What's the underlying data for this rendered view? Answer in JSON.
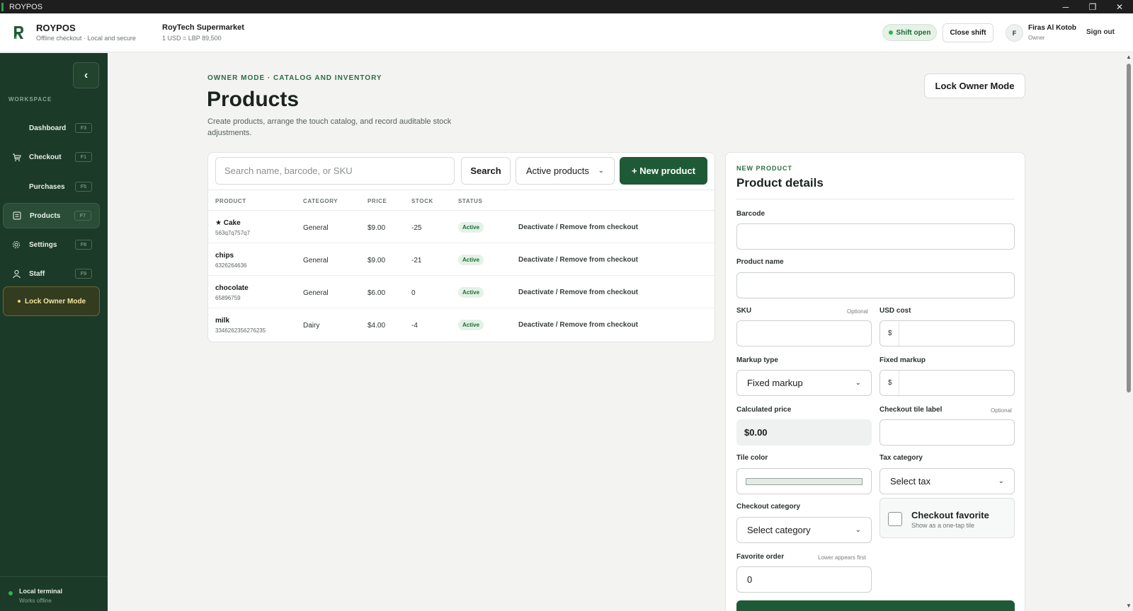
{
  "os": {
    "title": "ROYPOS",
    "minimize": "─",
    "maximize": "❐",
    "close": "✕"
  },
  "header": {
    "brand_name": "ROYPOS",
    "brand_tagline": "Offline checkout · Local and secure",
    "store_name": "RoyTech Supermarket",
    "exchange_rate": "1 USD = LBP 89,500",
    "shift_status": "Shift open",
    "close_shift": "Close shift",
    "avatar_initial": "F",
    "user_name": "Firas Al Kotob",
    "user_role": "Owner",
    "sign_out": "Sign out"
  },
  "sidebar": {
    "collapse_icon": "‹",
    "section_label": "WORKSPACE",
    "items": [
      {
        "label": "Dashboard",
        "key": "F3",
        "icon": "dashboard-icon",
        "glyph": ""
      },
      {
        "label": "Checkout",
        "key": "F1",
        "icon": "cart-icon",
        "glyph": "🛒"
      },
      {
        "label": "Purchases",
        "key": "F5",
        "icon": "purchases-icon",
        "glyph": ""
      },
      {
        "label": "Products",
        "key": "F7",
        "icon": "box-icon",
        "glyph": "▤",
        "active": true
      },
      {
        "label": "Settings",
        "key": "F8",
        "icon": "gear-icon",
        "glyph": "⚙"
      },
      {
        "label": "Staff",
        "key": "F9",
        "icon": "user-icon",
        "glyph": "👤"
      }
    ],
    "lock_owner_mode": "Lock Owner Mode",
    "terminal_name": "Local terminal",
    "terminal_status": "Works offline"
  },
  "main": {
    "eyebrow": "OWNER MODE · CATALOG AND INVENTORY",
    "title": "Products",
    "description": "Create products, arrange the touch catalog, and record auditable stock adjustments.",
    "lock_owner_mode": "Lock Owner Mode"
  },
  "list": {
    "search_placeholder": "Search name, barcode, or SKU",
    "search_button": "Search",
    "filter_selected": "Active products",
    "new_product": "+ New product",
    "columns": [
      "PRODUCT",
      "CATEGORY",
      "PRICE",
      "STOCK",
      "STATUS"
    ],
    "rows": [
      {
        "name": "★ Cake",
        "code": "563q7q757q7",
        "category": "General",
        "price": "$9.00",
        "stock": "-25",
        "status": "Active",
        "action": "Deactivate / Remove from checkout"
      },
      {
        "name": "chips",
        "code": "6326264636",
        "category": "General",
        "price": "$9.00",
        "stock": "-21",
        "status": "Active",
        "action": "Deactivate / Remove from checkout"
      },
      {
        "name": "chocolate",
        "code": "65896759",
        "category": "General",
        "price": "$6.00",
        "stock": "0",
        "status": "Active",
        "action": "Deactivate / Remove from checkout"
      },
      {
        "name": "milk",
        "code": "3346262356276235",
        "category": "Dairy",
        "price": "$4.00",
        "stock": "-4",
        "status": "Active",
        "action": "Deactivate / Remove from checkout"
      }
    ]
  },
  "form": {
    "eyebrow": "NEW PRODUCT",
    "title": "Product details",
    "barcode_label": "Barcode",
    "barcode_value": "",
    "name_label": "Product name",
    "name_value": "",
    "sku_label": "SKU",
    "sku_hint": "Optional",
    "sku_value": "",
    "usd_cost_label": "USD cost",
    "usd_cost_prefix": "$",
    "usd_cost_value": "",
    "markup_type_label": "Markup type",
    "markup_type_value": "Fixed markup",
    "fixed_markup_label": "Fixed markup",
    "fixed_markup_prefix": "$",
    "fixed_markup_value": "",
    "calculated_price_label": "Calculated price",
    "calculated_price_value": "$0.00",
    "tile_label_label": "Checkout tile label",
    "tile_label_hint": "Optional",
    "tile_label_value": "",
    "tile_color_label": "Tile color",
    "tile_color_value": "#e4ebe6",
    "tax_category_label": "Tax category",
    "tax_category_value": "Select tax",
    "checkout_category_label": "Checkout category",
    "checkout_category_value": "Select category",
    "favorite_title": "Checkout favorite",
    "favorite_subtitle": "Show as a one-tap tile",
    "favorite_checked": false,
    "favorite_order_label": "Favorite order",
    "favorite_order_hint": "Lower appears first",
    "favorite_order_value": "0"
  },
  "colors": {
    "sidebar_bg": "#1b3a28",
    "accent": "#1f5a36",
    "active_green": "#2db452"
  }
}
